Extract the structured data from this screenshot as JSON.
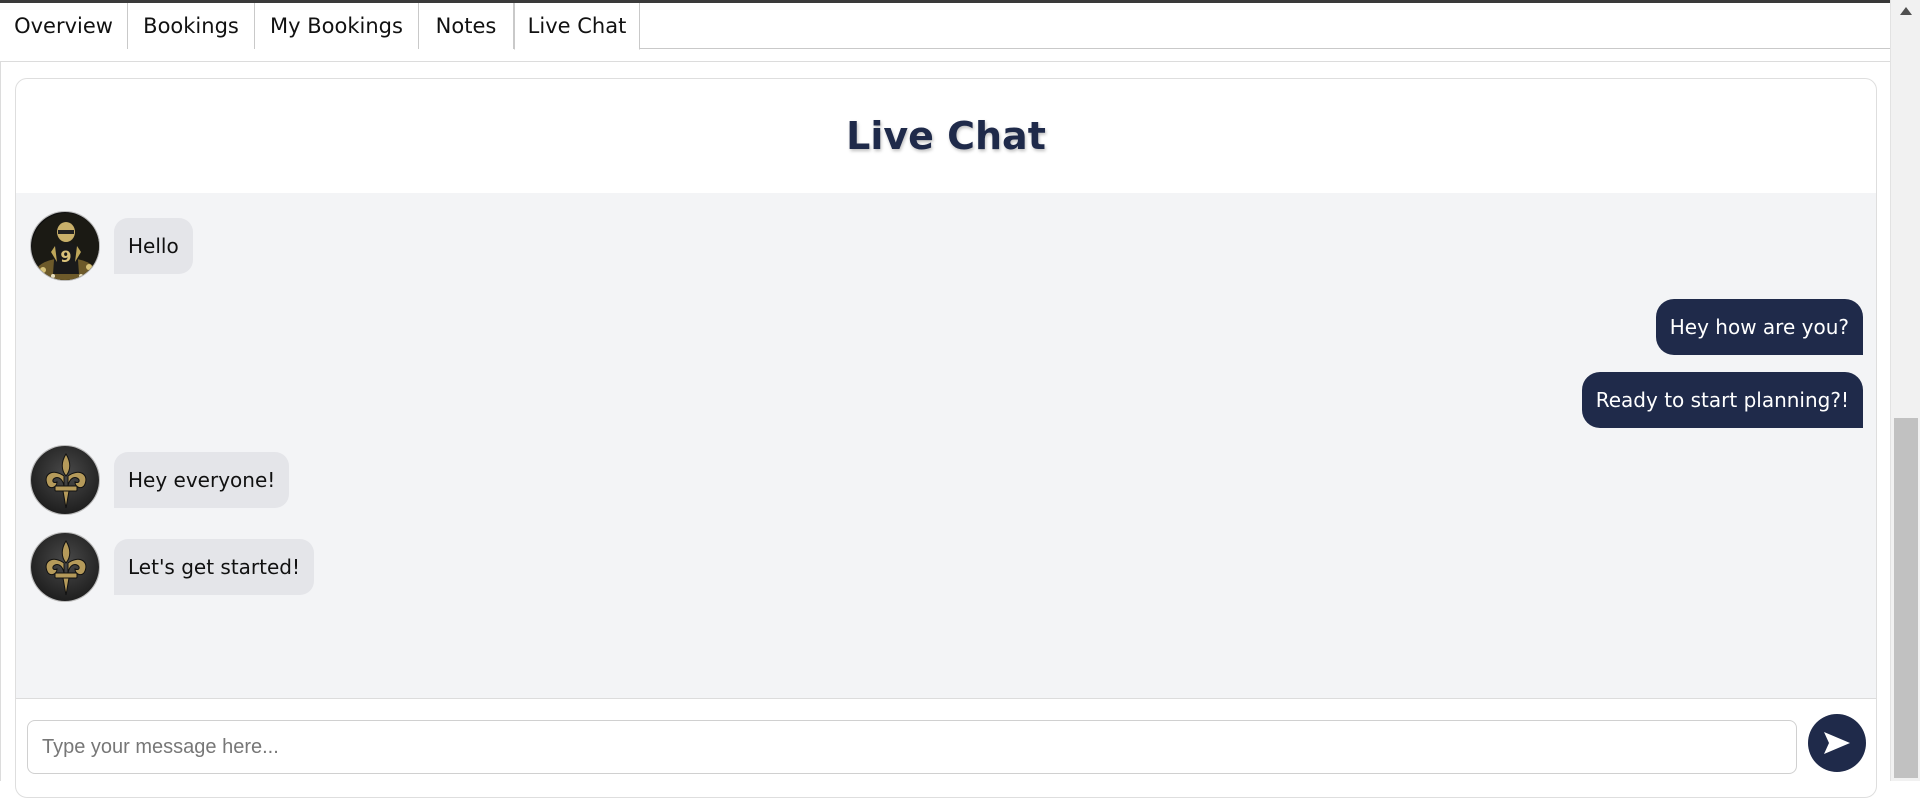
{
  "tabs": [
    {
      "label": "Overview",
      "active": false
    },
    {
      "label": "Bookings",
      "active": false
    },
    {
      "label": "My Bookings",
      "active": false
    },
    {
      "label": "Notes",
      "active": false
    },
    {
      "label": "Live Chat",
      "active": true
    }
  ],
  "chat": {
    "title": "Live Chat",
    "messages": [
      {
        "direction": "incoming",
        "avatar": "player-avatar-icon",
        "text": "Hello"
      },
      {
        "direction": "outgoing",
        "text": "Hey how are you?"
      },
      {
        "direction": "outgoing",
        "text": "Ready to start planning?!"
      },
      {
        "direction": "incoming",
        "avatar": "fleur-de-lis-avatar-icon",
        "text": "Hey everyone!"
      },
      {
        "direction": "incoming",
        "avatar": "fleur-de-lis-avatar-icon",
        "text": "Let's get started!"
      }
    ],
    "input": {
      "placeholder": "Type your message here...",
      "value": ""
    },
    "send_icon": "send-arrow-icon"
  },
  "colors": {
    "accent": "#1f2a4a",
    "messages_bg": "#f3f4f6",
    "incoming_bubble": "#e4e5e9"
  }
}
